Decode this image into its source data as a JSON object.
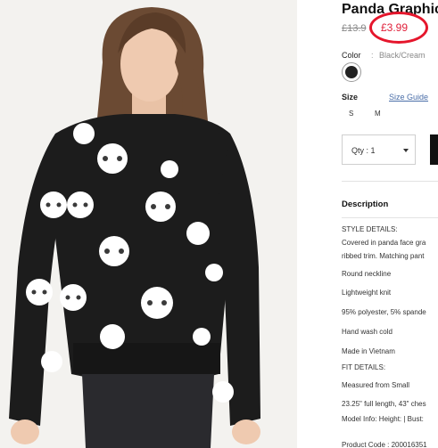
{
  "product": {
    "title": "Panda Graphic",
    "old_price": "£13.9",
    "new_price": "£3.99",
    "color_label": "Color",
    "color_separator": ":",
    "color_value": "Black/Cream",
    "swatch_color": "#222222",
    "size_label": "Size",
    "size_guide": "Size Guide",
    "sizes": [
      "S",
      "M"
    ],
    "quantity_label": "Qty : 1",
    "accent_color": "#e5162c"
  },
  "description": {
    "title": "Description",
    "lines": [
      "STYLE DETAILS:",
      "Covered in panda face gra",
      "ribbed trim. Matching pant",
      "Round neckline",
      "Lightweight knit",
      "95% polyester, 5% spande",
      "Hand wash cold",
      "Made in Vietnam",
      "FIT DETAILS:",
      "Measured from Small",
      "23.25\" full length, 43\" ches",
      "Model Info: Height: | Bust:",
      "Product Code : 200016351"
    ]
  }
}
